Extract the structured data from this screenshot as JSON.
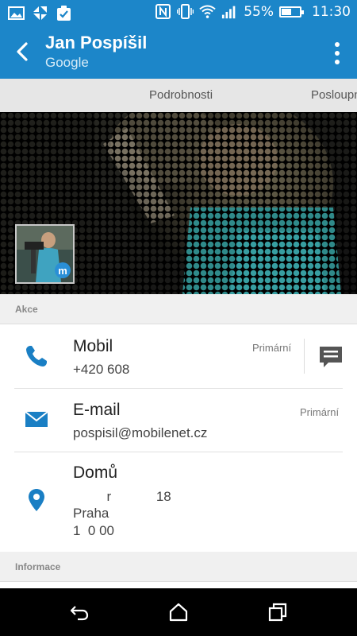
{
  "status_bar": {
    "battery_percent": "55%",
    "battery_level": 0.55,
    "time": "11:30"
  },
  "header": {
    "title": "Jan Pospíšil",
    "subtitle": "Google"
  },
  "tabs": [
    {
      "label": "Podrobnosti"
    },
    {
      "label": "Posloupnost"
    }
  ],
  "sections": {
    "actions": "Akce",
    "info": "Informace"
  },
  "contact": {
    "mobile": {
      "label": "Mobil",
      "value": "+420 608",
      "tag": "Primární"
    },
    "email": {
      "label": "E-mail",
      "value": "pospisil@mobilenet.cz",
      "tag": "Primární"
    },
    "home": {
      "label": "Domů",
      "address_line1": "         r            18",
      "address_line2": "Praha",
      "address_line3": "1  0 00"
    }
  },
  "colors": {
    "accent": "#1c86c9",
    "icon": "#1a7fc4"
  }
}
